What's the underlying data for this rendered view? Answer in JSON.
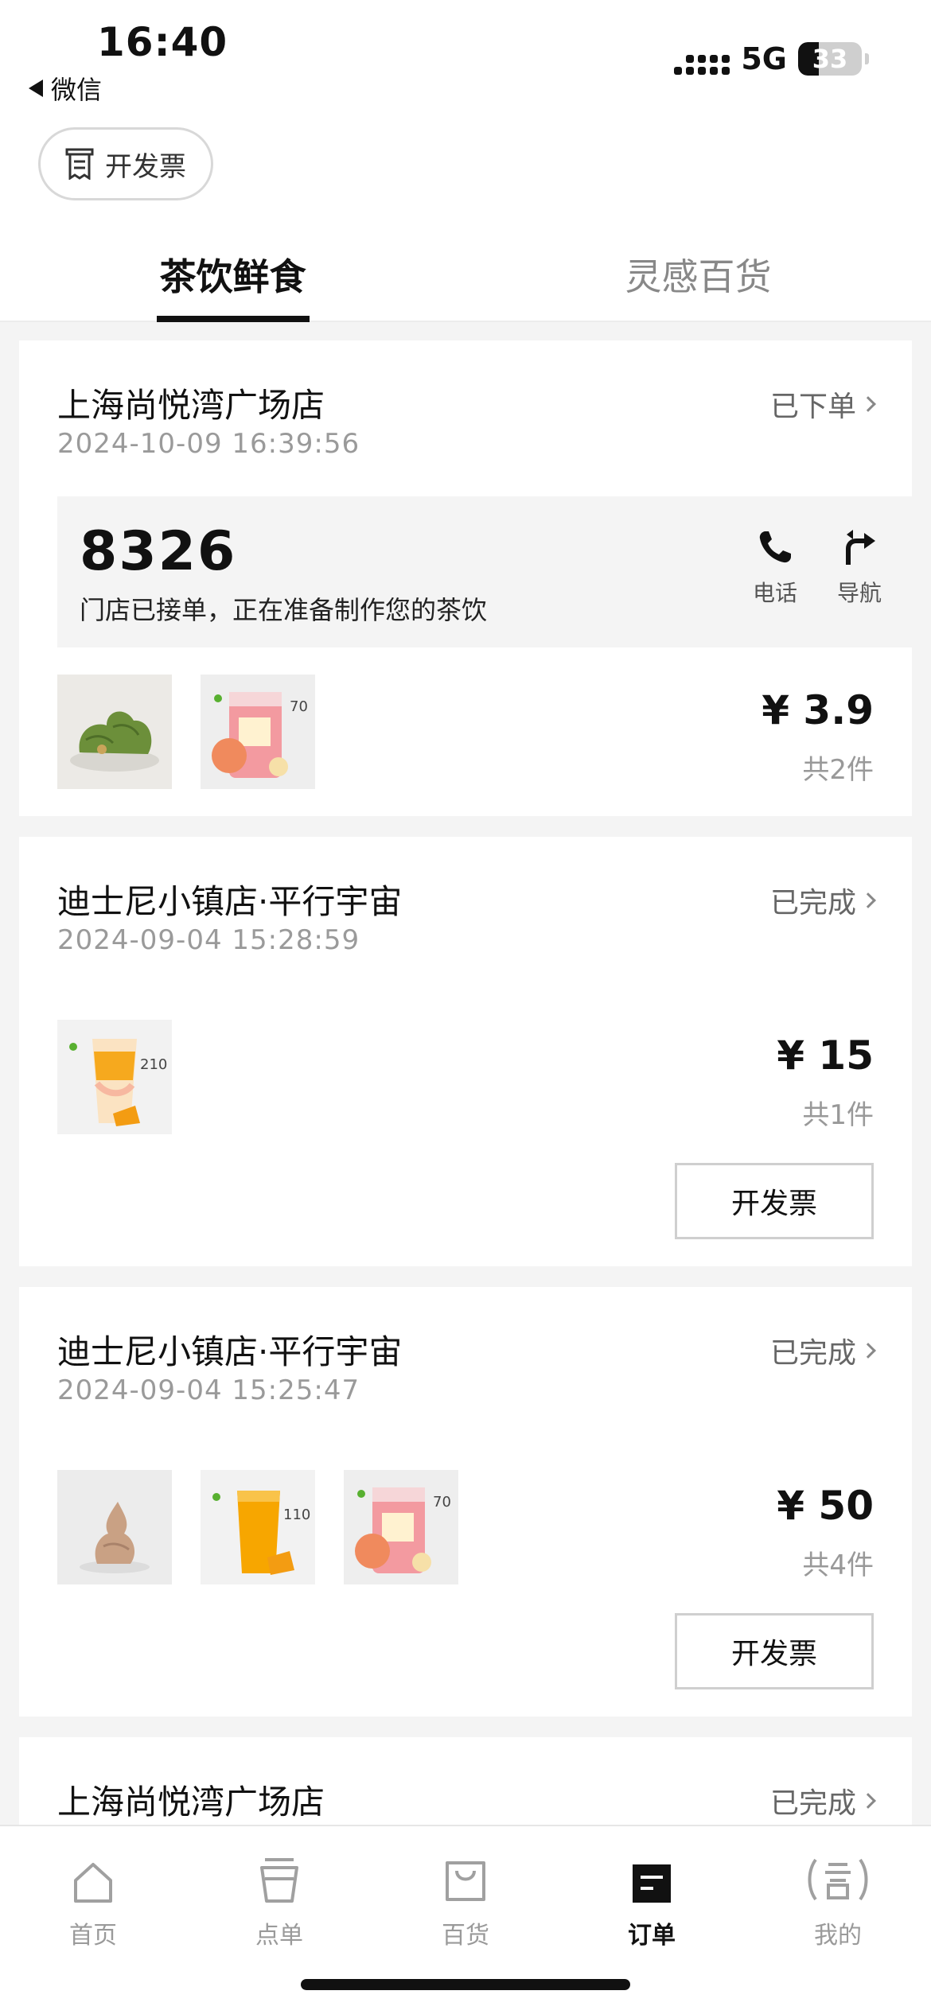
{
  "status_bar": {
    "time": "16:40",
    "back_app": "微信",
    "network": "5G",
    "battery": "33",
    "battery_level": 0.33
  },
  "header": {
    "invoice_button": "开发票"
  },
  "tabs": [
    {
      "label": "茶饮鲜食",
      "active": true
    },
    {
      "label": "灵感百货",
      "active": false
    }
  ],
  "orders": [
    {
      "shop": "上海尚悦湾广场店",
      "time": "2024-10-09 16:39:56",
      "status": "已下单",
      "pickup_code": "8326",
      "pickup_message": "门店已接单，正在准备制作您的茶饮",
      "actions": [
        "电话",
        "导航"
      ],
      "price": "¥ 3.9",
      "count": "共2件",
      "items": [
        "matcha-pastry",
        "peach-drink"
      ]
    },
    {
      "shop": "迪士尼小镇店·平行宇宙",
      "time": "2024-09-04 15:28:59",
      "status": "已完成",
      "price": "¥ 15",
      "count": "共1件",
      "items": [
        "mango-drink"
      ],
      "invoice_button": "开发票"
    },
    {
      "shop": "迪士尼小镇店·平行宇宙",
      "time": "2024-09-04 15:25:47",
      "status": "已完成",
      "price": "¥ 50",
      "count": "共4件",
      "items": [
        "chocolate-soft-serve",
        "mango-juice",
        "peach-drink"
      ],
      "invoice_button": "开发票"
    },
    {
      "shop": "上海尚悦湾广场店",
      "status": "已完成"
    }
  ],
  "bottom_nav": [
    {
      "label": "首页",
      "icon": "home-icon"
    },
    {
      "label": "点单",
      "icon": "cup-icon"
    },
    {
      "label": "百货",
      "icon": "shopping-bag-icon"
    },
    {
      "label": "订单",
      "icon": "order-icon",
      "active": true
    },
    {
      "label": "我的",
      "icon": "profile-icon"
    }
  ]
}
